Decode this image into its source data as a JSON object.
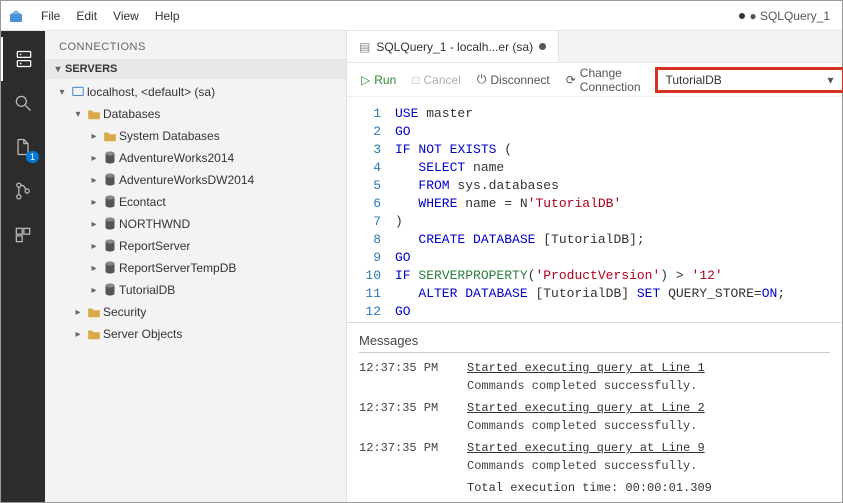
{
  "menubar": {
    "items": [
      "File",
      "Edit",
      "View",
      "Help"
    ],
    "window_title": "● SQLQuery_1"
  },
  "activitybar": {
    "badge": "1"
  },
  "sidebar": {
    "panel_title": "CONNECTIONS",
    "section": "SERVERS",
    "server_label": "localhost, <default> (sa)",
    "databases_label": "Databases",
    "databases": [
      "System Databases",
      "AdventureWorks2014",
      "AdventureWorksDW2014",
      "Econtact",
      "NORTHWND",
      "ReportServer",
      "ReportServerTempDB",
      "TutorialDB"
    ],
    "security_label": "Security",
    "server_objects_label": "Server Objects"
  },
  "tab": {
    "label": "SQLQuery_1 - localh...er (sa)"
  },
  "toolbar": {
    "run": "Run",
    "cancel": "Cancel",
    "disconnect": "Disconnect",
    "change_connection": "Change Connection",
    "db_selected": "TutorialDB"
  },
  "code": {
    "lines": [
      [
        {
          "t": "USE",
          "c": "kw"
        },
        {
          "t": " master"
        }
      ],
      [
        {
          "t": "GO",
          "c": "kw"
        }
      ],
      [
        {
          "t": "IF",
          "c": "kw"
        },
        {
          "t": " "
        },
        {
          "t": "NOT",
          "c": "kw"
        },
        {
          "t": " "
        },
        {
          "t": "EXISTS",
          "c": "kw"
        },
        {
          "t": " ("
        }
      ],
      [
        {
          "t": "   "
        },
        {
          "t": "SELECT",
          "c": "kw"
        },
        {
          "t": " name"
        }
      ],
      [
        {
          "t": "   "
        },
        {
          "t": "FROM",
          "c": "kw"
        },
        {
          "t": " sys"
        },
        {
          "t": ".",
          "c": ""
        },
        {
          "t": "databases"
        }
      ],
      [
        {
          "t": "   "
        },
        {
          "t": "WHERE",
          "c": "kw"
        },
        {
          "t": " name "
        },
        {
          "t": "=",
          "c": ""
        },
        {
          "t": " N"
        },
        {
          "t": "'TutorialDB'",
          "c": "str"
        }
      ],
      [
        {
          "t": ")"
        }
      ],
      [
        {
          "t": "   "
        },
        {
          "t": "CREATE",
          "c": "kw"
        },
        {
          "t": " "
        },
        {
          "t": "DATABASE",
          "c": "kw"
        },
        {
          "t": " [TutorialDB];"
        }
      ],
      [
        {
          "t": "GO",
          "c": "kw"
        }
      ],
      [
        {
          "t": "IF",
          "c": "kw"
        },
        {
          "t": " "
        },
        {
          "t": "SERVERPROPERTY",
          "c": "ident"
        },
        {
          "t": "("
        },
        {
          "t": "'ProductVersion'",
          "c": "str"
        },
        {
          "t": ") "
        },
        {
          "t": ">",
          "c": ""
        },
        {
          "t": " "
        },
        {
          "t": "'12'",
          "c": "str"
        }
      ],
      [
        {
          "t": "   "
        },
        {
          "t": "ALTER",
          "c": "kw"
        },
        {
          "t": " "
        },
        {
          "t": "DATABASE",
          "c": "kw"
        },
        {
          "t": " [TutorialDB] "
        },
        {
          "t": "SET",
          "c": "kw"
        },
        {
          "t": " QUERY_STORE"
        },
        {
          "t": "=",
          "c": ""
        },
        {
          "t": "ON",
          "c": "kw"
        },
        {
          "t": ";"
        }
      ],
      [
        {
          "t": "GO",
          "c": "kw"
        }
      ]
    ]
  },
  "messages": {
    "header": "Messages",
    "entries": [
      {
        "time": "12:37:35 PM",
        "head": "Started executing query at Line 1",
        "sub": "Commands completed successfully."
      },
      {
        "time": "12:37:35 PM",
        "head": "Started executing query at Line 2",
        "sub": "Commands completed successfully."
      },
      {
        "time": "12:37:35 PM",
        "head": "Started executing query at Line 9",
        "sub": "Commands completed successfully."
      }
    ],
    "total": "Total execution time: 00:00:01.309"
  }
}
